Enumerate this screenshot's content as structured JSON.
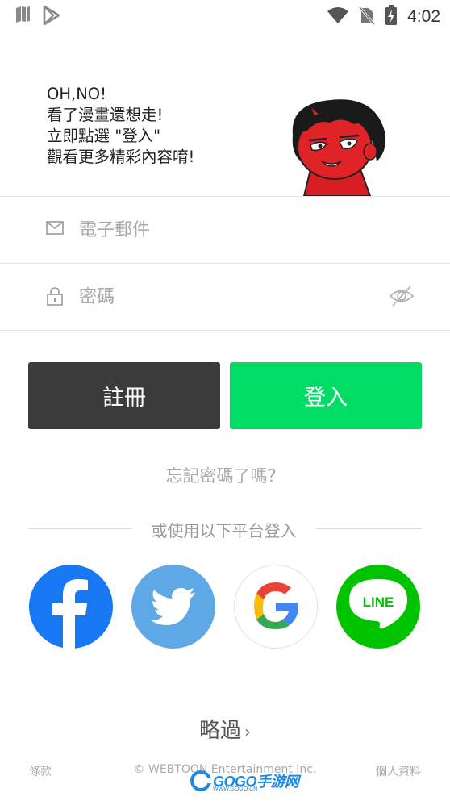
{
  "status_bar": {
    "time": "4:02",
    "icons": [
      "sim-card-icon",
      "play-store-icon",
      "wifi-icon",
      "no-sim-icon",
      "battery-charging-icon"
    ]
  },
  "promo": {
    "line1": "OH,NO!",
    "line2": "看了漫畫還想走!",
    "line3": "立即點選 \"登入\"",
    "line4": "觀看更多精彩內容唷!"
  },
  "form": {
    "email_placeholder": "電子郵件",
    "email_value": "",
    "password_placeholder": "密碼",
    "password_value": ""
  },
  "buttons": {
    "register_label": "註冊",
    "login_label": "登入"
  },
  "forgot_password": "忘記密碼了嗎？",
  "social_login": {
    "divider_text": "或使用以下平台登入",
    "platforms": [
      "facebook",
      "twitter",
      "google",
      "line"
    ],
    "line_label": "LINE"
  },
  "skip": {
    "label": "略過",
    "chevron": "›"
  },
  "footer": {
    "terms": "條款",
    "copyright": "© WEBTOON Entertainment Inc.",
    "privacy": "個人資料"
  },
  "watermark": {
    "text": "GOGO手游网",
    "sub": "WWW.GOGO.CN"
  },
  "colors": {
    "login_green": "#00dc64",
    "register_dark": "#3b3b3b",
    "facebook_blue": "#1877f2",
    "twitter_blue": "#5ea9e5",
    "line_green": "#00c300"
  }
}
